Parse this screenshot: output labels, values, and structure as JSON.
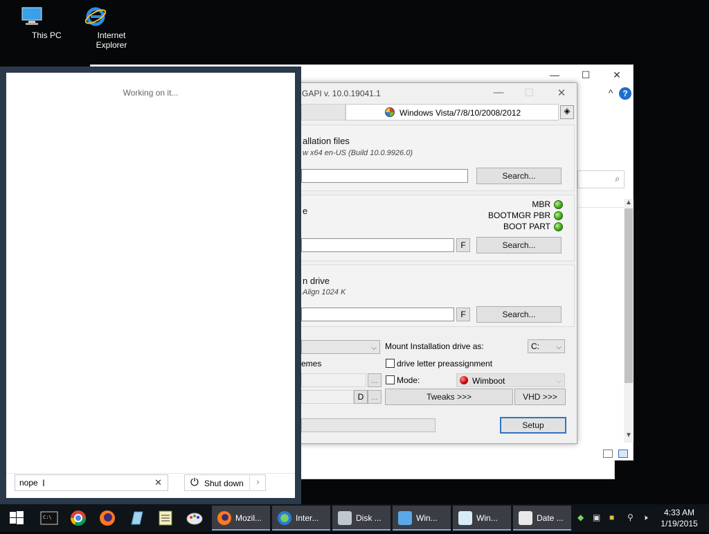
{
  "desktop": {
    "icons": [
      {
        "label": "This PC"
      },
      {
        "label": "Internet Explorer"
      }
    ]
  },
  "explorer": {
    "minimize": "—",
    "maximize": "☐",
    "close": "✕",
    "collapse": "^",
    "help": "?"
  },
  "setup_dialog": {
    "title": "GAPI v. 10.0.19041.1",
    "os_selector": "Windows Vista/7/8/10/2008/2012",
    "install_files": {
      "title": "allation files",
      "subtitle": "w  x64 en-US (Build 10.0.9926.0)",
      "search_label": "Search..."
    },
    "boot_drive": {
      "title": "e",
      "indicators": [
        "MBR",
        "BOOTMGR PBR",
        "BOOT PART"
      ],
      "format_label": "F",
      "search_label": "Search..."
    },
    "install_drive": {
      "title": "n drive",
      "subtitle": "Align 1024 K",
      "format_label": "F",
      "search_label": "Search..."
    },
    "options": {
      "mount_label": "Mount Installation drive as:",
      "mount_value": "C:",
      "themes_label": "emes",
      "letter_label": "drive letter preassignment",
      "mode_label": "Mode:",
      "mode_value": "Wimboot",
      "d_label": "D",
      "more_label": "...",
      "tweaks_label": "Tweaks >>>",
      "vhd_label": "VHD >>>"
    },
    "setup_label": "Setup"
  },
  "start_panel": {
    "status": "Working on it...",
    "search_value": "nope",
    "shutdown_label": "Shut down"
  },
  "taskbar": {
    "tasks": [
      {
        "label": "Mozil..."
      },
      {
        "label": "Inter..."
      },
      {
        "label": "Disk ..."
      },
      {
        "label": "Win..."
      },
      {
        "label": "Win..."
      },
      {
        "label": "Date ..."
      }
    ],
    "clock_time": "4:33 AM",
    "clock_date": "1/19/2015"
  }
}
